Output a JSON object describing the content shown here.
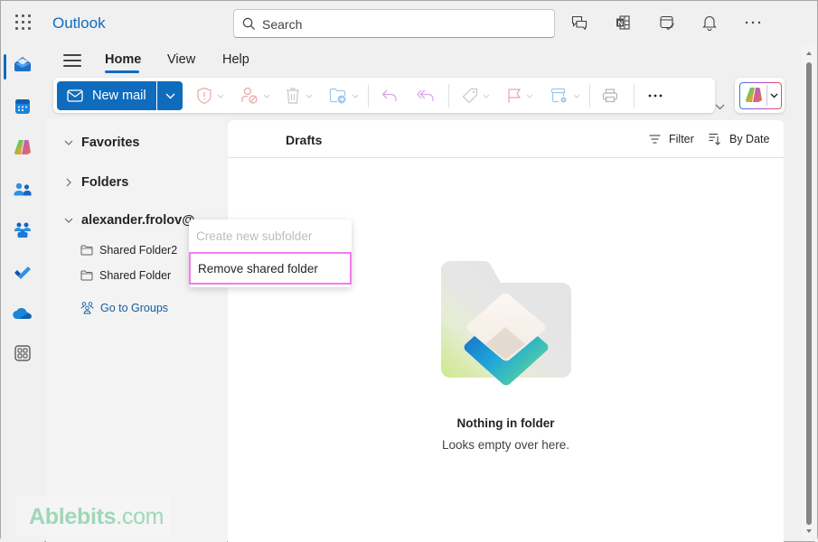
{
  "app": {
    "title": "Outlook"
  },
  "search": {
    "placeholder": "Search"
  },
  "topbar_icons": [
    {
      "name": "teams-chat-icon"
    },
    {
      "name": "onenote-icon"
    },
    {
      "name": "my-day-icon"
    },
    {
      "name": "notifications-bell-icon"
    },
    {
      "name": "more-options-icon"
    }
  ],
  "rail": {
    "items": [
      {
        "name": "mail",
        "active": true
      },
      {
        "name": "calendar"
      },
      {
        "name": "copilot"
      },
      {
        "name": "people"
      },
      {
        "name": "groups"
      },
      {
        "name": "to-do"
      },
      {
        "name": "onedrive"
      },
      {
        "name": "more-apps"
      }
    ]
  },
  "ribbon": {
    "tabs": [
      {
        "label": "Home",
        "active": true
      },
      {
        "label": "View"
      },
      {
        "label": "Help"
      }
    ],
    "new_mail_label": "New mail",
    "more_label": "···",
    "buttons": [
      "report",
      "block-sender",
      "delete",
      "move-to",
      "reply",
      "reply-all",
      "categorize",
      "flag",
      "rules",
      "print",
      "more"
    ]
  },
  "folder_pane": {
    "favorites_label": "Favorites",
    "folders_label": "Folders",
    "account_label": "alexander.frolov@.",
    "shared_folders": [
      {
        "label": "Shared Folder2"
      },
      {
        "label": "Shared Folder"
      }
    ],
    "go_to_groups_label": "Go to Groups"
  },
  "context_menu": {
    "items": [
      {
        "label": "Create new subfolder",
        "disabled": true
      },
      {
        "label": "Remove shared folder",
        "highlighted": true
      }
    ]
  },
  "message_list": {
    "folder_title": "Drafts",
    "filter_label": "Filter",
    "sort_label": "By Date",
    "empty_title": "Nothing in folder",
    "empty_subtitle": "Looks empty over here."
  },
  "watermark": {
    "brand": "Ablebits",
    "suffix": ".com"
  },
  "colors": {
    "accent": "#0f6cbd",
    "highlight_border": "#f07df0",
    "watermark": "#9fd7b8"
  }
}
